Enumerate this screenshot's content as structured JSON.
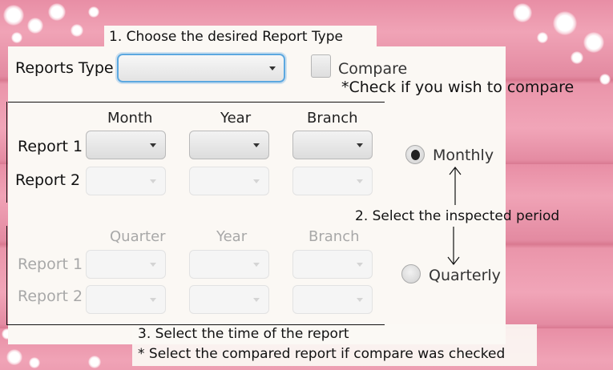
{
  "steps": {
    "step1": "1. Choose the desired Report Type",
    "step2": "2. Select the inspected period",
    "step3": "3. Select the time of the report",
    "step3_note": "* Select the compared report if compare was checked"
  },
  "reports_type": {
    "label": "Reports Type",
    "value": ""
  },
  "compare": {
    "label": "Compare",
    "note": "*Check if you wish to compare",
    "checked": false
  },
  "monthly_section": {
    "headers": [
      "Month",
      "Year",
      "Branch"
    ],
    "rows": [
      {
        "label": "Report 1",
        "enabled": true
      },
      {
        "label": "Report 2",
        "enabled": false
      }
    ]
  },
  "quarterly_section": {
    "headers": [
      "Quarter",
      "Year",
      "Branch"
    ],
    "rows": [
      {
        "label": "Report 1",
        "enabled": false
      },
      {
        "label": "Report 2",
        "enabled": false
      }
    ]
  },
  "period": {
    "options": [
      {
        "label": "Monthly",
        "selected": true
      },
      {
        "label": "Quarterly",
        "selected": false
      }
    ]
  }
}
